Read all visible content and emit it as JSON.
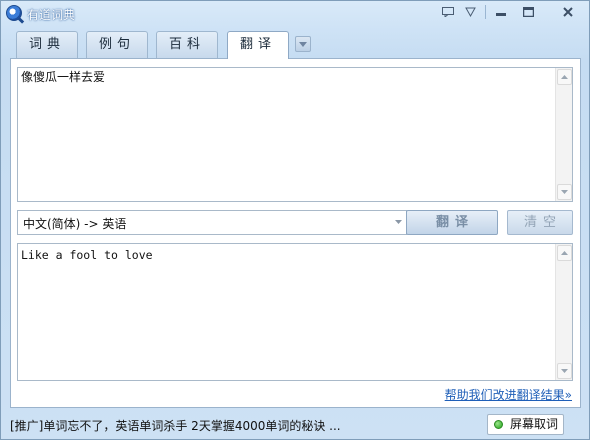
{
  "window": {
    "title": "有道词典",
    "controls": [
      "feedback-icon",
      "skin-icon",
      "minimize-icon",
      "maximize-icon",
      "close-icon"
    ]
  },
  "tabs": [
    {
      "label": "词典",
      "active": false
    },
    {
      "label": "例句",
      "active": false
    },
    {
      "label": "百科",
      "active": false
    },
    {
      "label": "翻译",
      "active": true
    }
  ],
  "translate": {
    "source_text": "像傻瓜一样去爱",
    "language_pair": "中文(简体) -> 英语",
    "translate_button": "翻译",
    "clear_button": "清空",
    "result_text": "Like a fool to love",
    "feedback_link": "帮助我们改进翻译结果»"
  },
  "statusbar": {
    "ad_text": "[推广]单词忘不了，英语单词杀手 2天掌握4000单词的秘诀 ...",
    "screen_capture_button": "屏幕取词"
  },
  "colors": {
    "window_bg": "#cde1f4",
    "link": "#1f5fb8",
    "indicator_green": "#23a31c"
  }
}
